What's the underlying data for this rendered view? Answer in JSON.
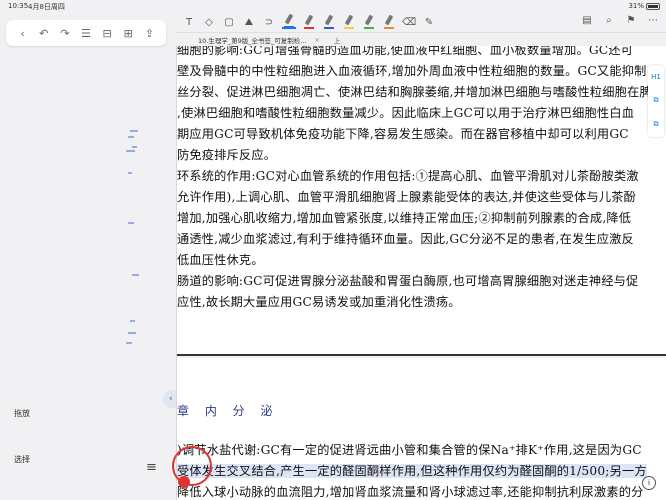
{
  "status": {
    "time": "10:35",
    "date": "4月8日周四",
    "battery": "31%"
  },
  "left_toolbar": {
    "icons": [
      "back-icon",
      "undo-icon",
      "redo-icon",
      "list-icon",
      "bookmark-icon",
      "grid-icon",
      "share-icon"
    ]
  },
  "sidebar": {
    "pan_label": "拖放",
    "select_label": "选择"
  },
  "scroll_handle_label": "‹ ›",
  "tab": {
    "title": "10.生理学_第9版_全书签_可复制检...",
    "close": "×",
    "up": "上"
  },
  "side_tools": [
    "H1",
    "⧉",
    "⧉"
  ],
  "heading": "章 内 分 泌",
  "page1_lines": [
    "细胞的影响:GC可增强骨髓的造血功能,使血液中红细胞、血小板数量增加。GC还可",
    "壁及骨髓中的中性粒细胞进入血液循环,增加外周血液中性粒细胞的数量。GC又能抑制",
    "丝分裂、促进淋巴细胞凋亡、使淋巴结和胸腺萎缩,并增加淋巴细胞与嗜酸性粒细胞在脾",
    ",使淋巴细胞和嗜酸性粒细胞数量减少。因此临床上GC可以用于治疗淋巴细胞性白血",
    "期应用GC可导致机体免疫功能下降,容易发生感染。而在器官移植中却可以利用GC",
    "防免疫排斥反应。",
    "环系统的作用:GC对心血管系统的作用包括:①提高心肌、血管平滑肌对儿茶酚胺类激",
    "允许作用),上调心肌、血管平滑肌细胞肾上腺素能受体的表达,并使这些受体与儿茶酚",
    "增加,加强心肌收缩力,增加血管紧张度,以维持正常血压;②抑制前列腺素的合成,降低",
    "通透性,减少血浆滤过,有利于维持循环血量。因此,GC分泌不足的患者,在发生应激反",
    "低血压性休克。",
    "肠道的影响:GC可促进胃腺分泌盐酸和胃蛋白酶原,也可增高胃腺细胞对迷走神经与促",
    "应性,故长期大量应用GC易诱发或加重消化性溃疡。"
  ],
  "page2_lines": [
    ")调节水盐代谢:GC有一定的促进肾远曲小管和集合管的保Na⁺排K⁺作用,这是因为GC",
    "受体发生交叉结合,产生一定的醛固酮样作用,但这种作用仅约为醛固酮的1/500;另一方",
    "降低入球小动脉的血流阻力,增加肾血浆流量和肾小球滤过率,还能抑制抗利尿激素的分"
  ]
}
